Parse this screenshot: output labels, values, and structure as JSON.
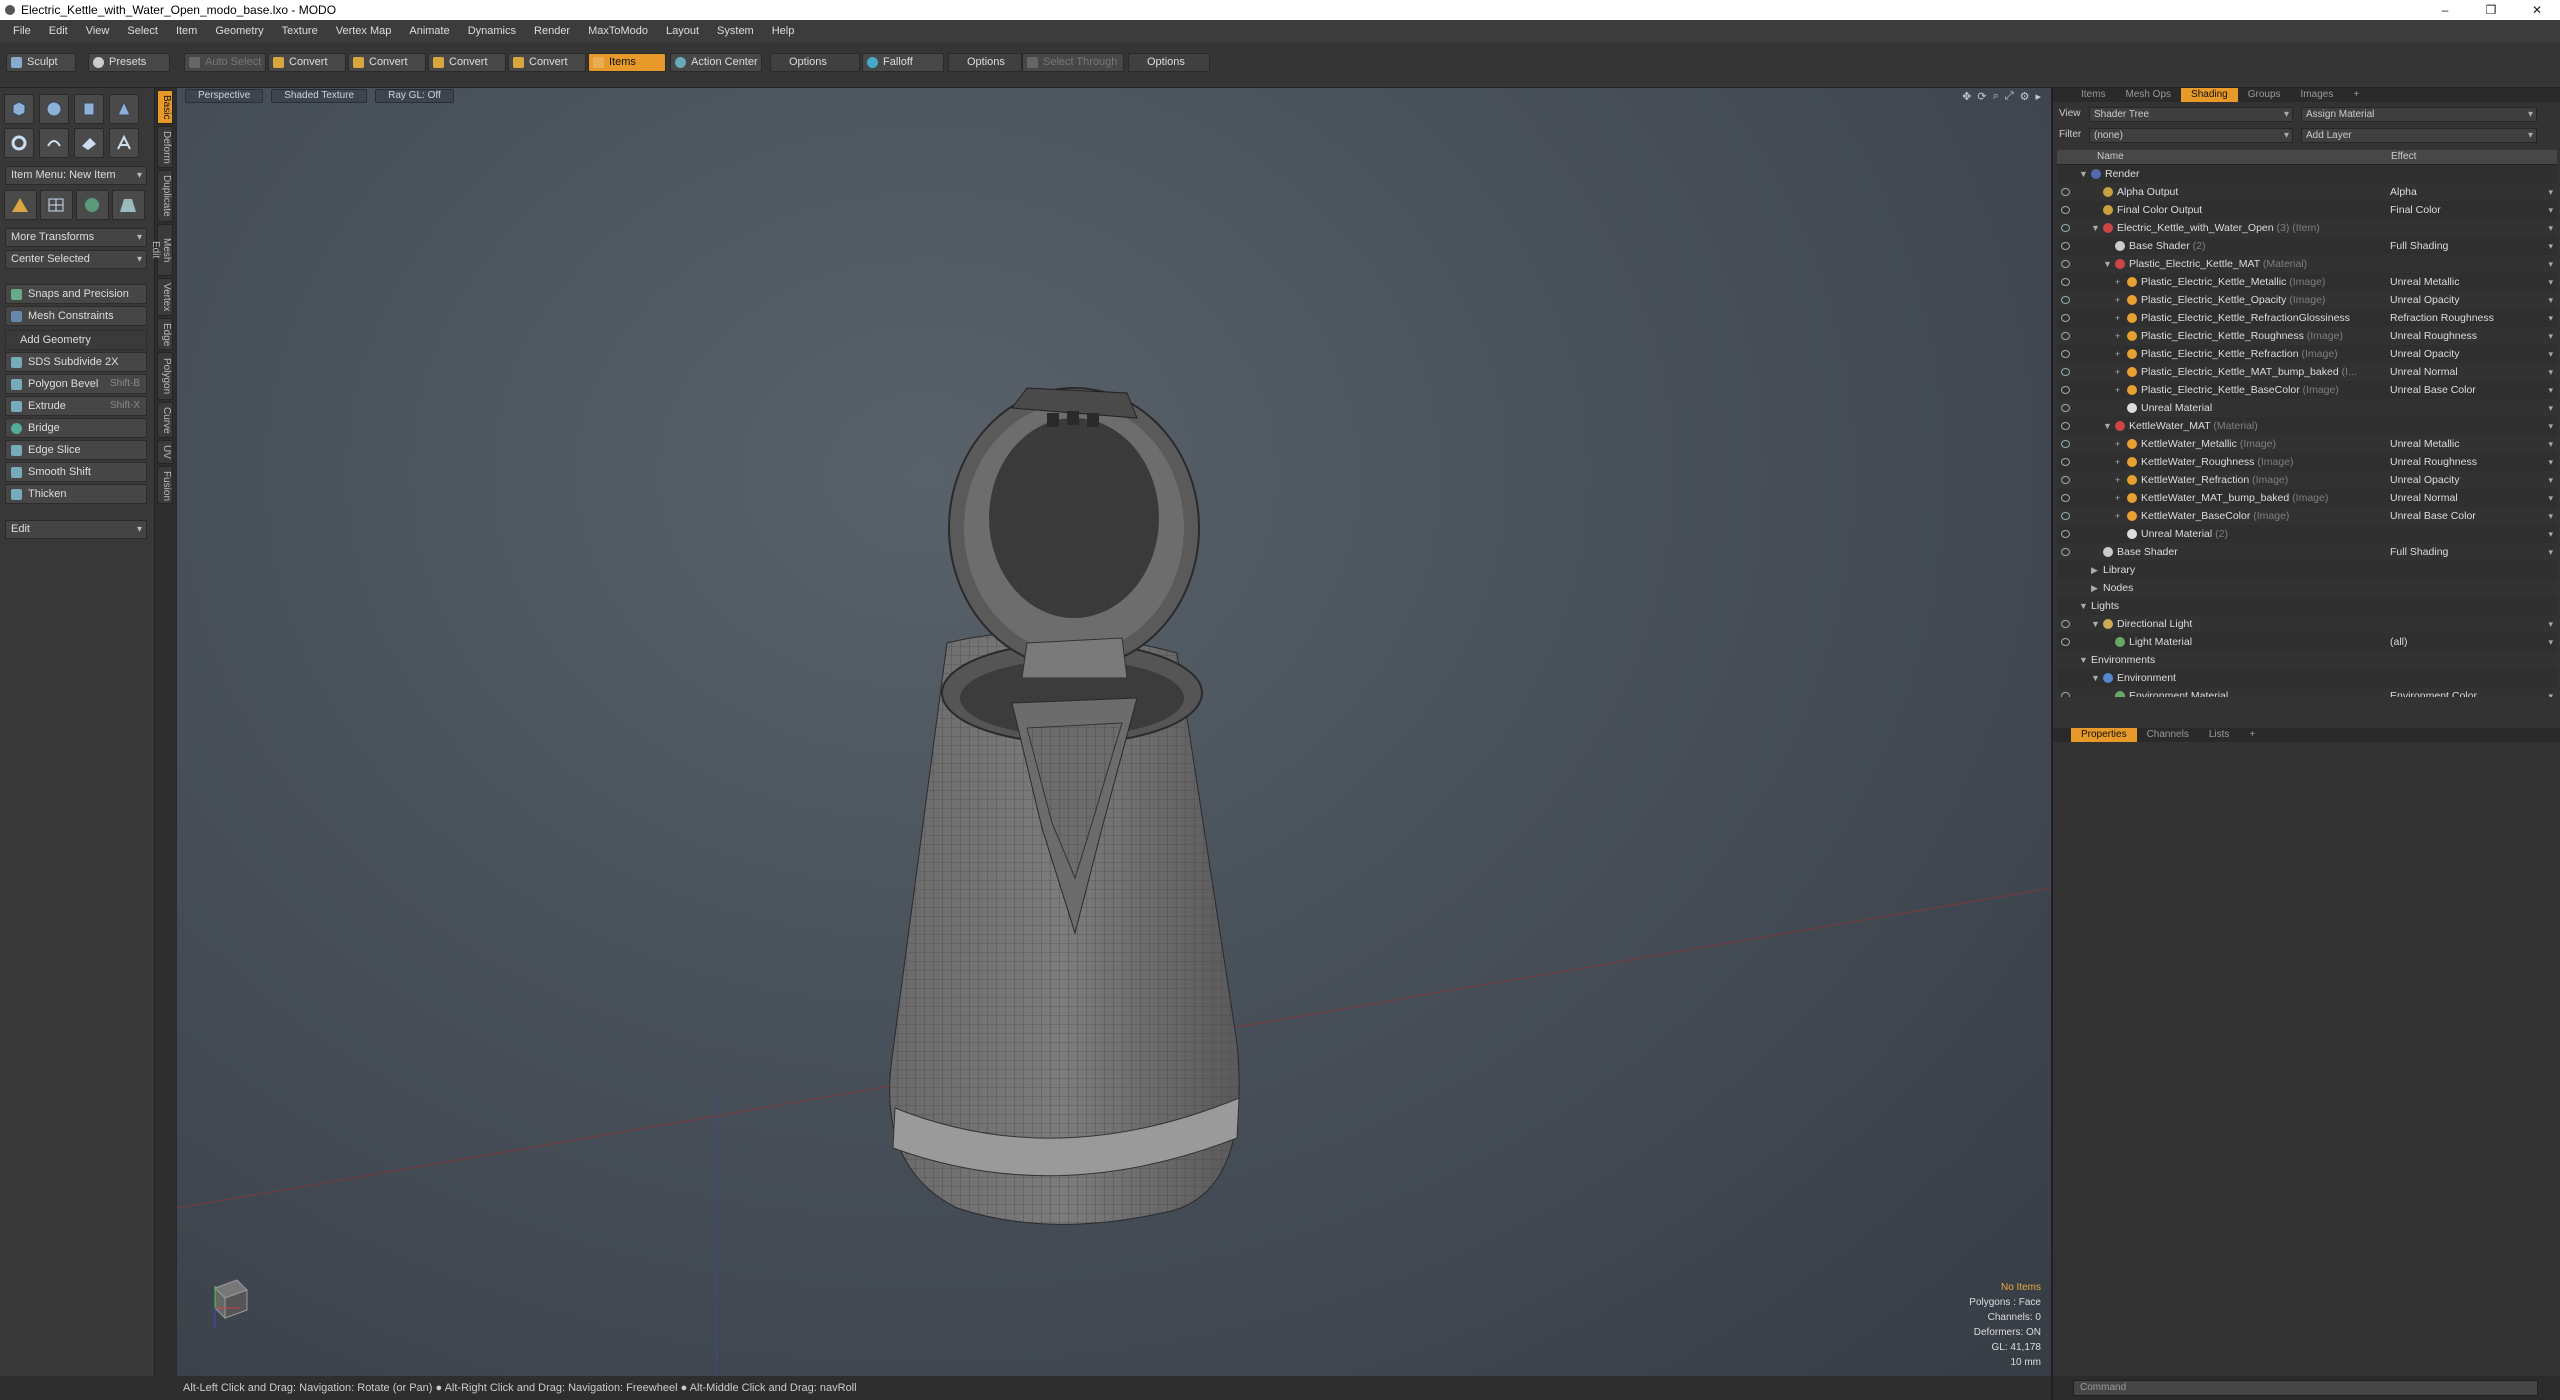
{
  "window": {
    "title": "Electric_Kettle_with_Water_Open_modo_base.lxo - MODO",
    "controls": [
      "–",
      "❐",
      "✕"
    ]
  },
  "menu": [
    "File",
    "Edit",
    "View",
    "Select",
    "Item",
    "Geometry",
    "Texture",
    "Vertex Map",
    "Animate",
    "Dynamics",
    "Render",
    "MaxToModo",
    "Layout",
    "System",
    "Help"
  ],
  "toolbar": {
    "sculpt": "Sculpt",
    "presets": "Presets",
    "auto_select": "Auto Select",
    "convert1": "Convert",
    "convert2": "Convert",
    "convert3": "Convert",
    "convert4": "Convert",
    "items": "Items",
    "action_center": "Action Center",
    "options1": "Options",
    "falloff": "Falloff",
    "options2": "Options",
    "select_through": "Select Through",
    "options3": "Options"
  },
  "toolbox": {
    "item_menu": "Item Menu: New Item",
    "more_transforms": "More Transforms",
    "center_selected": "Center Selected",
    "snaps": "Snaps and Precision",
    "mesh_constraints": "Mesh Constraints",
    "add_geometry": "Add Geometry",
    "tools": [
      {
        "label": "SDS Subdivide 2X",
        "shortcut": ""
      },
      {
        "label": "Polygon Bevel",
        "shortcut": "Shift-B"
      },
      {
        "label": "Extrude",
        "shortcut": "Shift-X"
      },
      {
        "label": "Bridge",
        "shortcut": ""
      },
      {
        "label": "Edge Slice",
        "shortcut": ""
      },
      {
        "label": "Smooth Shift",
        "shortcut": ""
      },
      {
        "label": "Thicken",
        "shortcut": ""
      }
    ],
    "edit": "Edit",
    "vtabs": [
      "Basic",
      "Deform",
      "Duplicate",
      "Mesh Edit",
      "Vertex",
      "Edge",
      "Polygon",
      "Curve",
      "UV",
      "Fusion"
    ]
  },
  "viewport": {
    "view": "Perspective",
    "shading": "Shaded Texture",
    "raygl": "Ray GL: Off",
    "info": {
      "items": "No Items",
      "polygons": "Polygons : Face",
      "channels": "Channels: 0",
      "deformers": "Deformers: ON",
      "gl": "GL: 41,178",
      "scale": "10 mm"
    }
  },
  "status": "Alt-Left Click and Drag: Navigation: Rotate (or Pan) ● Alt-Right Click and Drag: Navigation: Freewheel ● Alt-Middle Click and Drag: navRoll",
  "shading_panel": {
    "tabs": [
      "Items",
      "Mesh Ops",
      "Shading",
      "Groups",
      "Images",
      "+"
    ],
    "view_label": "View",
    "view_value": "Shader Tree",
    "assign_material": "Assign Material",
    "filter_label": "Filter",
    "filter_value": "(none)",
    "add_layer": "Add Layer",
    "col_name": "Name",
    "col_effect": "Effect",
    "rows": [
      {
        "indent": 0,
        "exp": "▼",
        "icon": "#5566aa",
        "name": "Render",
        "tag": "",
        "effect": "",
        "eye": false
      },
      {
        "indent": 1,
        "exp": "",
        "icon": "#c8a040",
        "name": "Alpha Output",
        "tag": "",
        "effect": "Alpha",
        "eye": true
      },
      {
        "indent": 1,
        "exp": "",
        "icon": "#c8a040",
        "name": "Final Color Output",
        "tag": "",
        "effect": "Final Color",
        "eye": true
      },
      {
        "indent": 1,
        "exp": "▼",
        "icon": "#c44",
        "name": "Electric_Kettle_with_Water_Open",
        "tag": " (3) (Item)",
        "effect": "",
        "eye": true
      },
      {
        "indent": 2,
        "exp": "",
        "icon": "#ccc",
        "name": "Base Shader",
        "tag": " (2)",
        "effect": "Full Shading",
        "eye": true
      },
      {
        "indent": 2,
        "exp": "▼",
        "icon": "#c44",
        "name": "Plastic_Electric_Kettle_MAT",
        "tag": " (Material)",
        "effect": "",
        "eye": true
      },
      {
        "indent": 3,
        "exp": "+",
        "icon": "#e8a030",
        "name": "Plastic_Electric_Kettle_Metallic",
        "tag": " (Image)",
        "effect": "Unreal Metallic",
        "eye": true
      },
      {
        "indent": 3,
        "exp": "+",
        "icon": "#e8a030",
        "name": "Plastic_Electric_Kettle_Opacity",
        "tag": " (Image)",
        "effect": "Unreal Opacity",
        "eye": true
      },
      {
        "indent": 3,
        "exp": "+",
        "icon": "#e8a030",
        "name": "Plastic_Electric_Kettle_RefractionGlossiness",
        "tag": "",
        "effect": "Refraction Roughness",
        "eye": true
      },
      {
        "indent": 3,
        "exp": "+",
        "icon": "#e8a030",
        "name": "Plastic_Electric_Kettle_Roughness",
        "tag": " (Image)",
        "effect": "Unreal Roughness",
        "eye": true
      },
      {
        "indent": 3,
        "exp": "+",
        "icon": "#e8a030",
        "name": "Plastic_Electric_Kettle_Refraction",
        "tag": " (Image)",
        "effect": "Unreal Opacity",
        "eye": true
      },
      {
        "indent": 3,
        "exp": "+",
        "icon": "#e8a030",
        "name": "Plastic_Electric_Kettle_MAT_bump_baked",
        "tag": " (I...",
        "effect": "Unreal Normal",
        "eye": true
      },
      {
        "indent": 3,
        "exp": "+",
        "icon": "#e8a030",
        "name": "Plastic_Electric_Kettle_BaseColor",
        "tag": " (Image)",
        "effect": "Unreal Base Color",
        "eye": true
      },
      {
        "indent": 3,
        "exp": "",
        "icon": "#ddd",
        "name": "Unreal Material",
        "tag": "",
        "effect": "",
        "eye": true
      },
      {
        "indent": 2,
        "exp": "▼",
        "icon": "#c44",
        "name": "KettleWater_MAT",
        "tag": " (Material)",
        "effect": "",
        "eye": true
      },
      {
        "indent": 3,
        "exp": "+",
        "icon": "#e8a030",
        "name": "KettleWater_Metallic",
        "tag": " (Image)",
        "effect": "Unreal Metallic",
        "eye": true
      },
      {
        "indent": 3,
        "exp": "+",
        "icon": "#e8a030",
        "name": "KettleWater_Roughness",
        "tag": " (Image)",
        "effect": "Unreal Roughness",
        "eye": true
      },
      {
        "indent": 3,
        "exp": "+",
        "icon": "#e8a030",
        "name": "KettleWater_Refraction",
        "tag": " (Image)",
        "effect": "Unreal Opacity",
        "eye": true
      },
      {
        "indent": 3,
        "exp": "+",
        "icon": "#e8a030",
        "name": "KettleWater_MAT_bump_baked",
        "tag": " (Image)",
        "effect": "Unreal Normal",
        "eye": true
      },
      {
        "indent": 3,
        "exp": "+",
        "icon": "#e8a030",
        "name": "KettleWater_BaseColor",
        "tag": " (Image)",
        "effect": "Unreal Base Color",
        "eye": true
      },
      {
        "indent": 3,
        "exp": "",
        "icon": "#ddd",
        "name": "Unreal Material",
        "tag": " (2)",
        "effect": "",
        "eye": true
      },
      {
        "indent": 1,
        "exp": "",
        "icon": "#ccc",
        "name": "Base Shader",
        "tag": "",
        "effect": "Full Shading",
        "eye": true
      },
      {
        "indent": 1,
        "exp": "▶",
        "icon": "",
        "name": "Library",
        "tag": "",
        "effect": "",
        "eye": false
      },
      {
        "indent": 1,
        "exp": "▶",
        "icon": "",
        "name": "Nodes",
        "tag": "",
        "effect": "",
        "eye": false
      },
      {
        "indent": 0,
        "exp": "▼",
        "icon": "",
        "name": "Lights",
        "tag": "",
        "effect": "",
        "eye": false
      },
      {
        "indent": 1,
        "exp": "▼",
        "icon": "#ccaa55",
        "name": "Directional Light",
        "tag": "",
        "effect": "",
        "eye": true
      },
      {
        "indent": 2,
        "exp": "",
        "icon": "#6a6",
        "name": "Light Material",
        "tag": "",
        "effect": "(all)",
        "eye": true
      },
      {
        "indent": 0,
        "exp": "▼",
        "icon": "",
        "name": "Environments",
        "tag": "",
        "effect": "",
        "eye": false
      },
      {
        "indent": 1,
        "exp": "▼",
        "icon": "#5588cc",
        "name": "Environment",
        "tag": "",
        "effect": "",
        "eye": false
      },
      {
        "indent": 2,
        "exp": "",
        "icon": "#6a6",
        "name": "Environment Material",
        "tag": "",
        "effect": "Environment Color",
        "eye": true
      }
    ]
  },
  "props_panel": {
    "tabs": [
      "Properties",
      "Channels",
      "Lists",
      "+"
    ]
  },
  "command": {
    "placeholder": "Command"
  }
}
